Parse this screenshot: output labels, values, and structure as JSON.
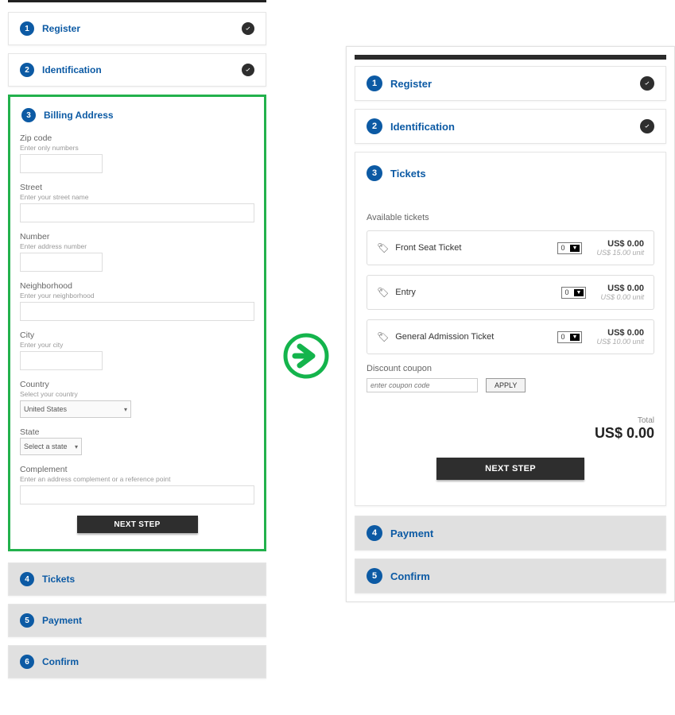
{
  "left": {
    "step1": {
      "num": "1",
      "title": "Register"
    },
    "step2": {
      "num": "2",
      "title": "Identification"
    },
    "step3": {
      "num": "3",
      "title": "Billing Address",
      "next_btn": "NEXT STEP",
      "fields": {
        "zip": {
          "label": "Zip code",
          "hint": "Enter only numbers"
        },
        "street": {
          "label": "Street",
          "hint": "Enter your street name"
        },
        "number": {
          "label": "Number",
          "hint": "Enter address number"
        },
        "neighborhood": {
          "label": "Neighborhood",
          "hint": "Enter your neighborhood"
        },
        "city": {
          "label": "City",
          "hint": "Enter your city"
        },
        "country": {
          "label": "Country",
          "hint": "Select your country",
          "value": "United States"
        },
        "state": {
          "label": "State",
          "value": "Select a state"
        },
        "complement": {
          "label": "Complement",
          "hint": "Enter an address complement or a reference point"
        }
      }
    },
    "step4": {
      "num": "4",
      "title": "Tickets"
    },
    "step5": {
      "num": "5",
      "title": "Payment"
    },
    "step6": {
      "num": "6",
      "title": "Confirm"
    }
  },
  "right": {
    "step1": {
      "num": "1",
      "title": "Register"
    },
    "step2": {
      "num": "2",
      "title": "Identification"
    },
    "step3": {
      "num": "3",
      "title": "Tickets",
      "available_label": "Available tickets",
      "tickets": {
        "t0": {
          "name": "Front Seat Ticket",
          "qty": "0",
          "price": "US$ 0.00",
          "unit": "US$ 15.00 unit"
        },
        "t1": {
          "name": "Entry",
          "qty": "0",
          "price": "US$ 0.00",
          "unit": "US$ 0.00 unit"
        },
        "t2": {
          "name": "General Admission Ticket",
          "qty": "0",
          "price": "US$ 0.00",
          "unit": "US$ 10.00 unit"
        }
      },
      "coupon_label": "Discount coupon",
      "coupon_placeholder": "enter coupon code",
      "apply_btn": "APPLY",
      "total_label": "Total",
      "total_value": "US$ 0.00",
      "next_btn": "NEXT STEP"
    },
    "step4": {
      "num": "4",
      "title": "Payment"
    },
    "step5": {
      "num": "5",
      "title": "Confirm"
    }
  }
}
